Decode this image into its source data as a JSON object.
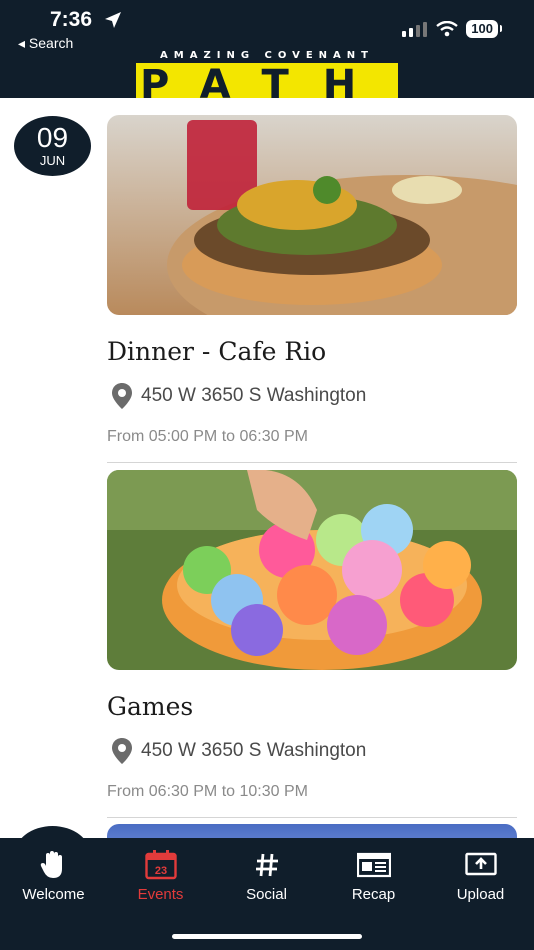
{
  "status_bar": {
    "time": "7:36",
    "back_label": "◂ Search",
    "battery": "100"
  },
  "brand": {
    "subtitle": "AMAZING   COVENANT",
    "logo_text": "PATH",
    "logo_color": "#f3e600",
    "header_bg": "#101e2b"
  },
  "date_badge": {
    "day": "09",
    "month": "JUN"
  },
  "events": [
    {
      "title": "Dinner - Cafe Rio",
      "address": "450 W 3650 S Washington",
      "time": "From 05:00 PM to 06:30 PM",
      "image_icon": "food-salad-photo"
    },
    {
      "title": "Games",
      "address": "450 W 3650 S Washington",
      "time": "From 06:30 PM to 10:30 PM",
      "image_icon": "water-balloons-photo"
    }
  ],
  "tabs": [
    {
      "label": "Welcome",
      "icon": "hand-wave-icon",
      "active": false
    },
    {
      "label": "Events",
      "icon": "calendar-icon",
      "calendar_number": "23",
      "active": true
    },
    {
      "label": "Social",
      "icon": "hash-icon",
      "active": false
    },
    {
      "label": "Recap",
      "icon": "newspaper-icon",
      "active": false
    },
    {
      "label": "Upload",
      "icon": "upload-icon",
      "active": false
    }
  ],
  "colors": {
    "active_tab": "#e23b3b",
    "nav_bg": "#101e2b"
  }
}
